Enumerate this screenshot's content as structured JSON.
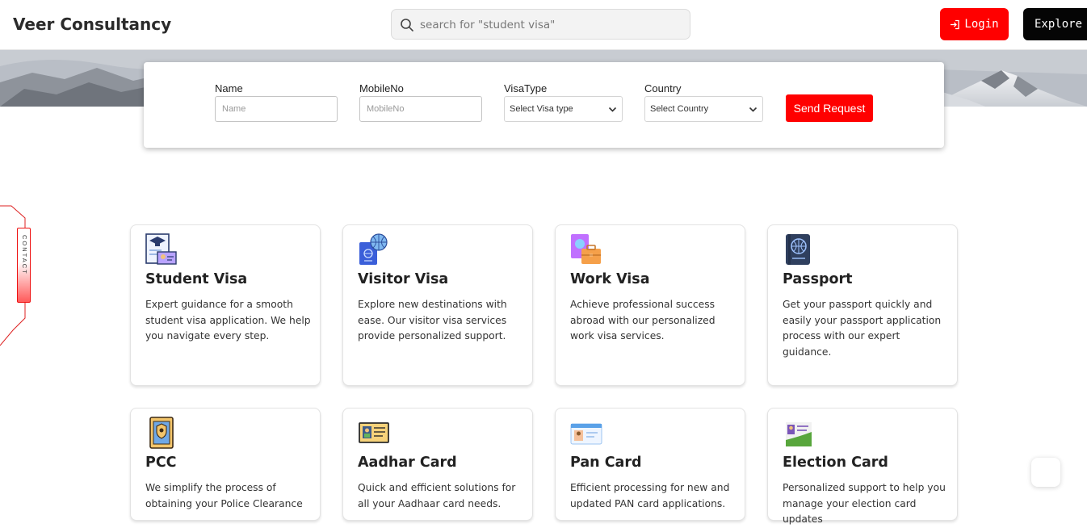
{
  "header": {
    "brand": "Veer Consultancy",
    "search_placeholder": "search for \"student visa\"",
    "login_label": "Login",
    "explore_label": "Explore"
  },
  "form": {
    "name_label": "Name",
    "name_placeholder": "Name",
    "mobile_label": "MobileNo",
    "mobile_placeholder": "MobileNo",
    "visa_label": "VisaType",
    "visa_selected": "Select Visa type",
    "country_label": "Country",
    "country_selected": "Select Country",
    "send_label": "Send Request"
  },
  "contact_tab": "CONTACT",
  "services": [
    {
      "title": "Student Visa",
      "desc": "Expert guidance for a smooth student visa application. We help you navigate every step.",
      "icon": "student-visa-icon"
    },
    {
      "title": "Visitor Visa",
      "desc": "Explore new destinations with ease. Our visitor visa services provide personalized support.",
      "icon": "visitor-visa-icon"
    },
    {
      "title": "Work Visa",
      "desc": "Achieve professional success abroad with our personalized work visa services.",
      "icon": "work-visa-icon"
    },
    {
      "title": "Passport",
      "desc": "Get your passport quickly and easily your passport application process with our expert guidance.",
      "icon": "passport-icon"
    },
    {
      "title": "PCC",
      "desc": "We simplify the process of obtaining your Police Clearance",
      "icon": "pcc-icon"
    },
    {
      "title": "Aadhar Card",
      "desc": "Quick and efficient solutions for all your Aadhaar card needs.",
      "icon": "aadhar-card-icon"
    },
    {
      "title": "Pan Card",
      "desc": "Efficient processing for new and updated PAN card applications.",
      "icon": "pan-card-icon"
    },
    {
      "title": "Election Card",
      "desc": "Personalized support to help you manage your election card updates",
      "icon": "election-card-icon"
    }
  ],
  "colors": {
    "accent": "#ff0000",
    "explore_bg": "#050505"
  }
}
